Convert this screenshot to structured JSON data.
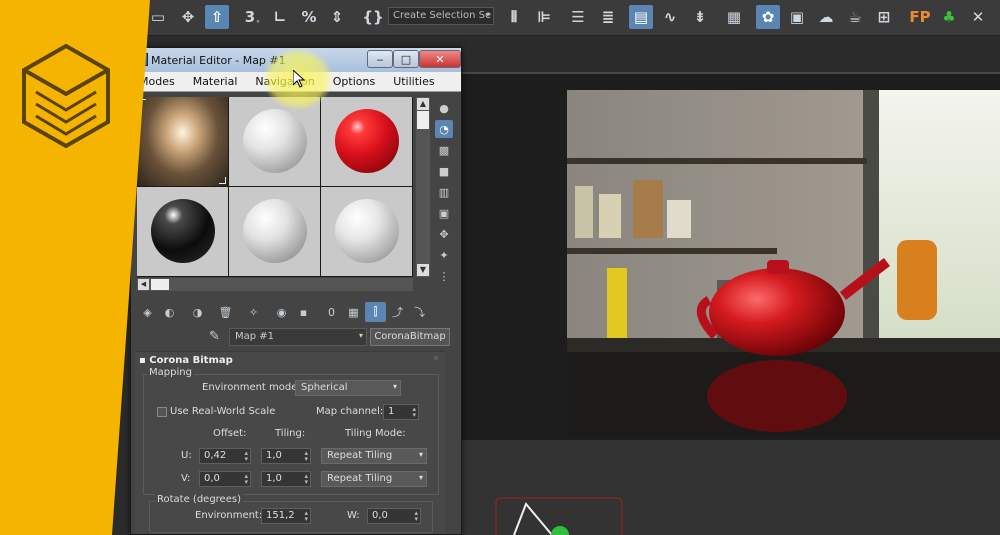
{
  "toolbar": {
    "selection_set_label": "Create Selection Se",
    "dropdown_arrow": "▾"
  },
  "material_editor": {
    "title": "Material Editor - Map #1",
    "menu": [
      "Modes",
      "Material",
      "Navigation",
      "Options",
      "Utilities"
    ],
    "window_buttons": {
      "minimize": "‒",
      "maximize": "□",
      "close": "✕"
    },
    "slots": [
      {
        "name": "hdri-map",
        "selected": true
      },
      {
        "name": "white-matte",
        "selected": false
      },
      {
        "name": "red-glossy",
        "selected": false
      },
      {
        "name": "black-glossy",
        "selected": false
      },
      {
        "name": "white-sphere-2",
        "selected": false
      },
      {
        "name": "white-sphere-3",
        "selected": false
      }
    ],
    "map_name": "Map #1",
    "map_type": "CoronaBitmap",
    "rollout": {
      "title": "Corona Bitmap",
      "pin": "◦",
      "mapping_group": "Mapping",
      "environment_mode_label": "Environment mode:",
      "environment_mode_value": "Spherical",
      "use_real_world_scale_label": "Use Real-World Scale",
      "use_real_world_scale_checked": false,
      "map_channel_label": "Map channel:",
      "map_channel_value": "1",
      "offset_label": "Offset:",
      "tiling_label": "Tiling:",
      "tiling_mode_label": "Tiling Mode:",
      "u_label": "U:",
      "v_label": "V:",
      "u_offset": "0,42",
      "v_offset": "0,0",
      "u_tiling": "1,0",
      "v_tiling": "1,0",
      "u_tiling_mode": "Repeat Tiling",
      "v_tiling_mode": "Repeat Tiling",
      "rotate_group": "Rotate (degrees)",
      "environment_label": "Environment:",
      "environment_value": "151,2",
      "w_label": "W:",
      "w_value": "0,0"
    }
  },
  "colors": {
    "brand_yellow": "#f5b400",
    "accent_blue": "#5b86b4",
    "teapot_red": "#c8141a"
  }
}
